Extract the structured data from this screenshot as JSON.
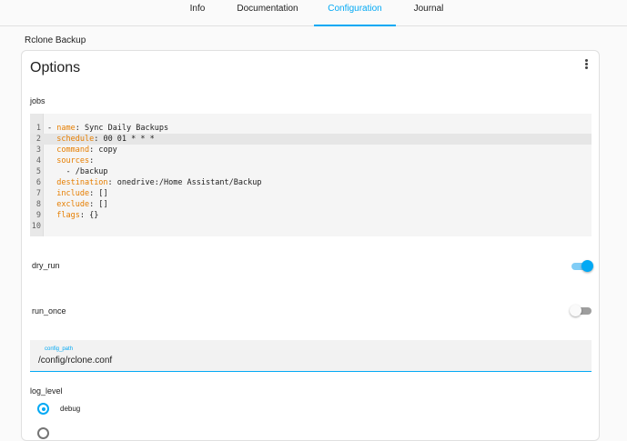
{
  "tabs": [
    {
      "label": "Info",
      "active": false
    },
    {
      "label": "Documentation",
      "active": false
    },
    {
      "label": "Configuration",
      "active": true
    },
    {
      "label": "Journal",
      "active": false
    }
  ],
  "breadcrumb": "Rclone Backup",
  "card": {
    "title": "Options",
    "menu_icon": "more-vertical-icon"
  },
  "jobs": {
    "label": "jobs",
    "lines": [
      {
        "num": "1",
        "prefix": "- ",
        "key": "name",
        "sep": ": ",
        "value": "Sync Daily Backups"
      },
      {
        "num": "2",
        "prefix": "  ",
        "key": "schedule",
        "sep": ": ",
        "value": "00 01 * * *"
      },
      {
        "num": "3",
        "prefix": "  ",
        "key": "command",
        "sep": ": ",
        "value": "copy"
      },
      {
        "num": "4",
        "prefix": "  ",
        "key": "sources",
        "sep": ":",
        "value": ""
      },
      {
        "num": "5",
        "prefix": "    ",
        "key": "",
        "sep": "",
        "value": "- /backup"
      },
      {
        "num": "6",
        "prefix": "  ",
        "key": "destination",
        "sep": ": ",
        "value": "onedrive:/Home Assistant/Backup"
      },
      {
        "num": "7",
        "prefix": "  ",
        "key": "include",
        "sep": ": ",
        "value": "[]"
      },
      {
        "num": "8",
        "prefix": "  ",
        "key": "exclude",
        "sep": ": ",
        "value": "[]"
      },
      {
        "num": "9",
        "prefix": "  ",
        "key": "flags",
        "sep": ": ",
        "value": "{}"
      },
      {
        "num": "10",
        "prefix": "",
        "key": "",
        "sep": "",
        "value": ""
      }
    ],
    "active_line": 2
  },
  "dry_run": {
    "label": "dry_run",
    "checked": true
  },
  "run_once": {
    "label": "run_once",
    "checked": false
  },
  "config_path": {
    "label": "config_path",
    "value": "/config/rclone.conf"
  },
  "log_level": {
    "label": "log_level",
    "options": [
      {
        "label": "debug",
        "selected": true
      }
    ]
  },
  "colors": {
    "accent": "#03a9f4",
    "yaml_key": "#e67e00"
  }
}
